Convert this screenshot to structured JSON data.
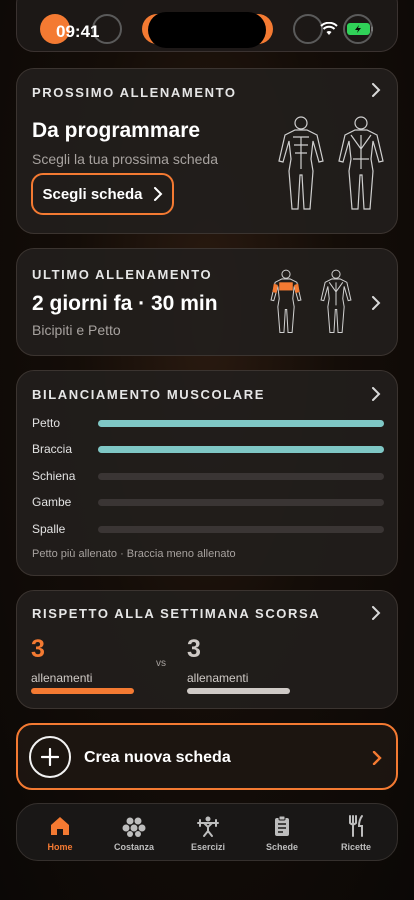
{
  "status": {
    "time": "09:41"
  },
  "next_workout": {
    "title": "PROSSIMO ALLENAMENTO",
    "headline": "Da programmare",
    "subtitle": "Scegli la tua prossima scheda",
    "button_label": "Scegli scheda"
  },
  "last_workout": {
    "title": "ULTIMO ALLENAMENTO",
    "headline": "2 giorni fa · 30 min",
    "subtitle": "Bicipiti e Petto"
  },
  "balance": {
    "title": "BILANCIAMENTO MUSCOLARE",
    "groups": [
      {
        "label": "Petto",
        "level": 1.0
      },
      {
        "label": "Braccia",
        "level": 1.0
      },
      {
        "label": "Schiena",
        "level": 0.0
      },
      {
        "label": "Gambe",
        "level": 0.0
      },
      {
        "label": "Spalle",
        "level": 0.0
      }
    ],
    "footnote": "Petto più allenato · Braccia meno allenato"
  },
  "comparison": {
    "title": "RISPETTO ALLA SETTIMANA SCORSA",
    "current_value": "3",
    "current_label": "allenamenti",
    "vs_label": "vs",
    "previous_value": "3",
    "previous_label": "allenamenti"
  },
  "create": {
    "label": "Crea nuova scheda"
  },
  "tabs": [
    {
      "label": "Home",
      "icon": "home-icon",
      "active": true
    },
    {
      "label": "Costanza",
      "icon": "hexagons-icon",
      "active": false
    },
    {
      "label": "Esercizi",
      "icon": "weightlifter-icon",
      "active": false
    },
    {
      "label": "Schede",
      "icon": "clipboard-icon",
      "active": false
    },
    {
      "label": "Ricette",
      "icon": "fork-knife-icon",
      "active": false
    }
  ],
  "colors": {
    "accent": "#f47a32",
    "bar_fill": "#7fc7c5",
    "bar_track": "#3a3534"
  }
}
